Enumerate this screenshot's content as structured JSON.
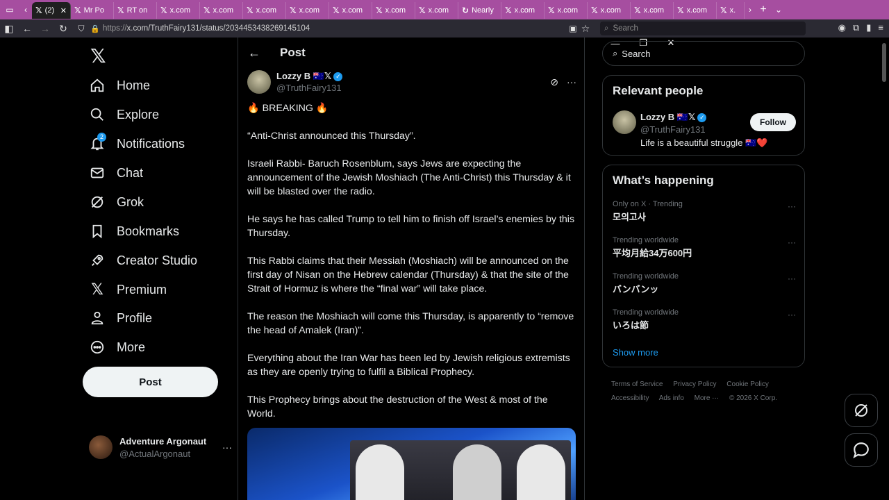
{
  "browser": {
    "tabs": [
      {
        "label": "(2)",
        "active": true
      },
      {
        "label": "Mr Po",
        "active": false
      },
      {
        "label": "RT on",
        "active": false
      },
      {
        "label": "x.com",
        "active": false
      },
      {
        "label": "x.com",
        "active": false
      },
      {
        "label": "x.com",
        "active": false
      },
      {
        "label": "x.com",
        "active": false
      },
      {
        "label": "x.com",
        "active": false
      },
      {
        "label": "x.com",
        "active": false
      },
      {
        "label": "x.com",
        "active": false
      },
      {
        "label": "Nearly",
        "active": false
      },
      {
        "label": "x.com",
        "active": false
      },
      {
        "label": "x.com",
        "active": false
      },
      {
        "label": "x.com",
        "active": false
      },
      {
        "label": "x.com",
        "active": false
      },
      {
        "label": "x.com",
        "active": false
      },
      {
        "label": "x.",
        "active": false
      }
    ],
    "url_prefix": "https://",
    "url_main": "x.com/TruthFairy131/status/2034453438269145104",
    "search_placeholder": "Search",
    "tab_color": "#a64ea0"
  },
  "sidebar": {
    "items": [
      {
        "label": "Home",
        "icon": "home-icon"
      },
      {
        "label": "Explore",
        "icon": "search-icon"
      },
      {
        "label": "Notifications",
        "icon": "bell-icon",
        "badge": "2"
      },
      {
        "label": "Chat",
        "icon": "mail-icon"
      },
      {
        "label": "Grok",
        "icon": "grok-icon"
      },
      {
        "label": "Bookmarks",
        "icon": "bookmark-icon"
      },
      {
        "label": "Creator Studio",
        "icon": "rocket-icon"
      },
      {
        "label": "Premium",
        "icon": "x-logo-icon"
      },
      {
        "label": "Profile",
        "icon": "person-icon"
      },
      {
        "label": "More",
        "icon": "more-circle-icon"
      }
    ],
    "post_label": "Post",
    "account": {
      "name": "Adventure Argonaut",
      "handle": "@ActualArgonaut"
    }
  },
  "main": {
    "header_title": "Post",
    "author": {
      "name": "Lozzy B 🇦🇺𝕏",
      "handle": "@TruthFairy131"
    },
    "paragraphs": [
      "🔥 BREAKING 🔥",
      "“Anti-Christ announced this Thursday”.",
      "Israeli Rabbi- Baruch Rosenblum, says Jews are expecting the announcement of the Jewish Moshiach (The Anti-Christ) this Thursday & it will be blasted over the radio.",
      "He says he has called Trump to tell him to finish off Israel’s enemies by this Thursday.",
      "This Rabbi claims that their Messiah (Moshiach) will be announced on the first day of Nisan on the Hebrew calendar (Thursday) & that the site of the Strait of Hormuz is where the “final war” will take place.",
      "The reason the Moshiach will come this Thursday, is apparently to “remove the head of Amalek (Iran)”.",
      "Everything about the Iran War has been led by Jewish religious extremists as they are openly trying to fulfil a Biblical Prophecy.",
      "This Prophecy brings about the destruction of the West & most of the World."
    ]
  },
  "right": {
    "search_placeholder": "Search",
    "relevant_title": "Relevant people",
    "person": {
      "name": "Lozzy B 🇦🇺𝕏",
      "handle": "@TruthFairy131",
      "bio": "Life is a beautiful struggle 🇦🇺❤️",
      "follow_label": "Follow"
    },
    "happening_title": "What’s happening",
    "trends": [
      {
        "context": "Only on X · Trending",
        "title": "모의고사"
      },
      {
        "context": "Trending worldwide",
        "title": "平均月給34万600円"
      },
      {
        "context": "Trending worldwide",
        "title": "バンバンッ"
      },
      {
        "context": "Trending worldwide",
        "title": "いろは節"
      }
    ],
    "show_more": "Show more",
    "footer": [
      "Terms of Service",
      "Privacy Policy",
      "Cookie Policy",
      "Accessibility",
      "Ads info",
      "More ···",
      "© 2026 X Corp."
    ]
  },
  "colors": {
    "accent": "#1d9bf0",
    "background": "#000000",
    "border": "#2f3336",
    "muted": "#71767b"
  }
}
